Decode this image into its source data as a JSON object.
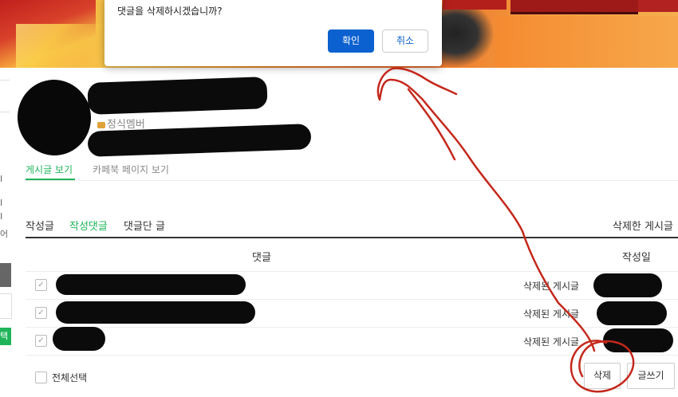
{
  "dialog": {
    "message": "댓글을 삭제하시겠습니까?",
    "ok_label": "확인",
    "cancel_label": "취소"
  },
  "profile": {
    "member_grade": "정식멤버"
  },
  "tabs": [
    {
      "label": "게시글 보기",
      "active": true
    },
    {
      "label": "카페북 페이지 보기",
      "active": false
    }
  ],
  "submenu": {
    "items": [
      {
        "label": "작성글",
        "active": false
      },
      {
        "label": "작성댓글",
        "active": true
      },
      {
        "label": "댓글단 글",
        "active": false
      }
    ],
    "deleted_link": "삭제한 게시글"
  },
  "table": {
    "headers": {
      "comment": "댓글",
      "date": "작성일"
    },
    "rows": [
      {
        "status": "삭제된 게시글",
        "checked": true
      },
      {
        "status": "삭제된 게시글",
        "checked": true
      },
      {
        "status": "삭제된 게시글",
        "checked": true
      }
    ]
  },
  "footer": {
    "select_all_label": "전체선택",
    "delete_label": "삭제",
    "write_label": "글쓰기"
  },
  "left_strip": {
    "chars": [
      "I",
      "I",
      "I",
      "어",
      "택"
    ]
  },
  "colors": {
    "accent_green": "#1fb45a",
    "dialog_blue": "#0b61d0",
    "annotation_red": "#c4281c"
  }
}
